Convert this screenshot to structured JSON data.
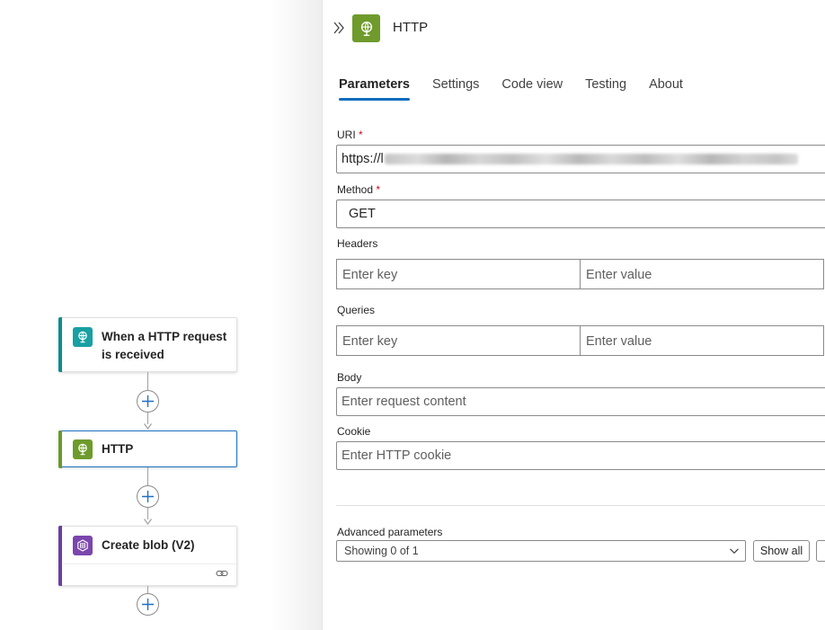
{
  "canvas": {
    "nodes": [
      {
        "title": "When a HTTP request is received",
        "icon": "http-request-trigger-icon",
        "accent": "#0e8b8e"
      },
      {
        "title": "HTTP",
        "icon": "http-globe-icon",
        "accent": "#6a9a2a",
        "selected": true
      },
      {
        "title": "Create blob (V2)",
        "icon": "blob-storage-icon",
        "accent": "#6b3fa0"
      }
    ]
  },
  "panel": {
    "title": "HTTP",
    "tabs": [
      "Parameters",
      "Settings",
      "Code view",
      "Testing",
      "About"
    ],
    "active_tab": "Parameters",
    "fields": {
      "uri": {
        "label": "URI",
        "required_mark": "*",
        "value_prefix": "https://l"
      },
      "method": {
        "label": "Method",
        "required_mark": "*",
        "value": "GET"
      },
      "headers": {
        "label": "Headers",
        "key_placeholder": "Enter key",
        "value_placeholder": "Enter value"
      },
      "queries": {
        "label": "Queries",
        "key_placeholder": "Enter key",
        "value_placeholder": "Enter value"
      },
      "body": {
        "label": "Body",
        "placeholder": "Enter request content"
      },
      "cookie": {
        "label": "Cookie",
        "placeholder": "Enter HTTP cookie"
      }
    },
    "advanced": {
      "label": "Advanced parameters",
      "select_value": "Showing 0 of 1",
      "show_all_label": "Show all"
    }
  },
  "colors": {
    "accent_blue": "#0f6cbd",
    "required_red": "#c50f1f",
    "http_green": "#6e9b2c",
    "trigger_teal": "#18a0a3",
    "blob_purple": "#7b46ad"
  }
}
